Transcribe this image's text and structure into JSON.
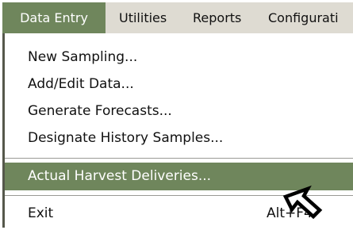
{
  "menubar": {
    "items": [
      {
        "label": "Data Entry",
        "active": true
      },
      {
        "label": "Utilities",
        "active": false
      },
      {
        "label": "Reports",
        "active": false
      },
      {
        "label": "Configurati",
        "active": false
      }
    ]
  },
  "dropdown": {
    "items": [
      {
        "label": "New Sampling..."
      },
      {
        "label": "Add/Edit Data..."
      },
      {
        "label": "Generate Forecasts..."
      },
      {
        "label": "Designate History Samples..."
      },
      {
        "label": "Actual Harvest Deliveries...",
        "highlighted": true
      },
      {
        "label": "Exit",
        "shortcut": "Alt+F4"
      }
    ]
  },
  "colors": {
    "menubar_bg": "#dedbd2",
    "highlight": "#6f865c",
    "highlight_text": "#ffffff"
  },
  "cursor": {
    "icon": "mouse-pointer-icon"
  }
}
